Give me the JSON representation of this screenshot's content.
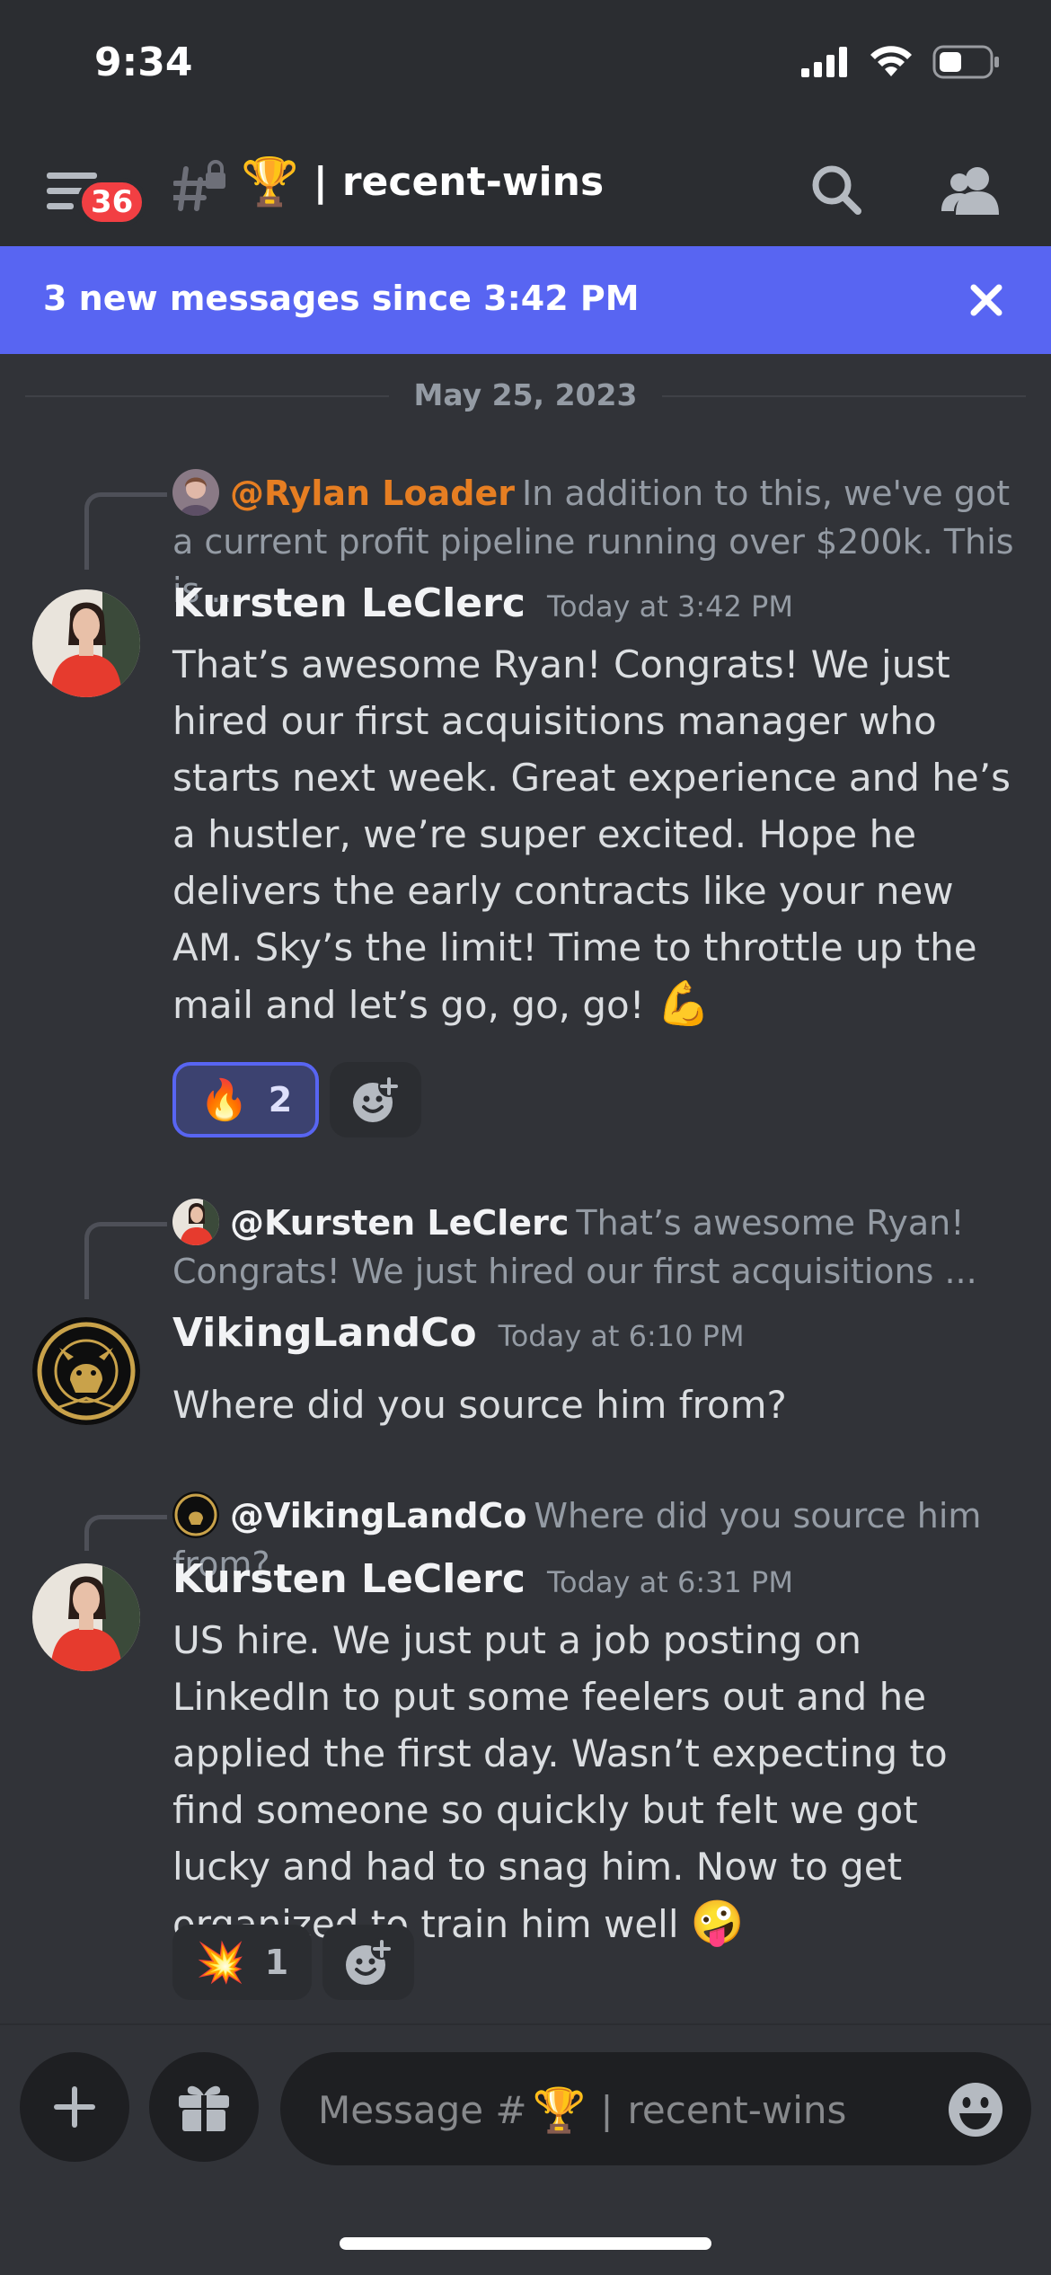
{
  "status_bar": {
    "time": "9:34"
  },
  "header": {
    "unread_badge": "36",
    "channel_emoji": "🏆",
    "channel_sep": "|",
    "channel_name": "recent-wins"
  },
  "new_messages_bar": {
    "text": "3 new messages since 3:42 PM"
  },
  "date_divider": "May 25, 2023",
  "messages": [
    {
      "reply_to": {
        "mention": "@Rylan Loader",
        "mention_color": "#e67e22",
        "snippet": "In addition to this, we've got a current profit pipeline running over $200k. This is ..."
      },
      "author": "Kursten LeClerc",
      "timestamp": "Today at 3:42 PM",
      "text": "That’s awesome Ryan! Congrats! We just hired our first acquisitions manager who starts next week. Great experience and he’s a hustler, we’re super excited. Hope he delivers the early contracts like your new AM. Sky’s the limit! Time to throttle up the mail and let’s go, go, go!",
      "trailing_emoji": "💪",
      "reactions": [
        {
          "emoji": "🔥",
          "count": "2",
          "active": true
        }
      ]
    },
    {
      "reply_to": {
        "mention": "@Kursten LeClerc",
        "mention_color": "#f2f3f5",
        "snippet": "That’s awesome Ryan! Congrats! We just hired our first acquisitions ..."
      },
      "author": "VikingLandCo",
      "timestamp": "Today at 6:10 PM",
      "text": "Where did you source him from?",
      "reactions": []
    },
    {
      "reply_to": {
        "mention": "@VikingLandCo",
        "mention_color": "#f2f3f5",
        "snippet": "Where did you source him from?"
      },
      "author": "Kursten LeClerc",
      "timestamp": "Today at 6:31 PM",
      "text": "US hire. We just put a job posting on LinkedIn to put some feelers out and he applied the first day. Wasn’t expecting to find someone so quickly but felt we got lucky and had to snag him. Now to get organized to train him well",
      "trailing_emoji": "🤪",
      "reactions": [
        {
          "emoji": "💥",
          "count": "1",
          "active": false
        }
      ]
    }
  ],
  "composer": {
    "placeholder_prefix": "Message #",
    "placeholder_emoji": "🏆",
    "placeholder_sep": "|",
    "placeholder_channel": "recent-wins"
  },
  "icons": [
    "signal-icon",
    "wifi-icon",
    "battery-icon",
    "hamburger-icon",
    "locked-channel-icon",
    "search-icon",
    "members-icon",
    "close-icon",
    "add-reaction-icon",
    "plus-icon",
    "gift-icon",
    "emoji-icon"
  ]
}
